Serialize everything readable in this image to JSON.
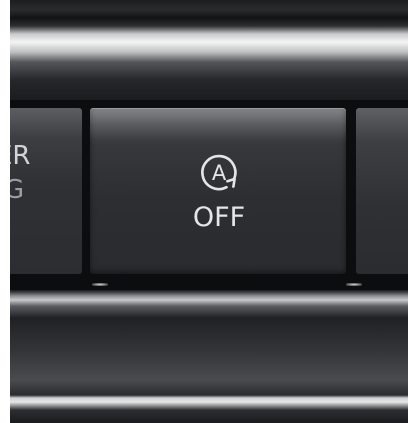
{
  "buttons": {
    "left": {
      "line1": "ER",
      "line2": "G"
    },
    "main": {
      "icon": "auto-start-stop-icon",
      "icon_letter": "A",
      "label": "OFF"
    },
    "right": {}
  }
}
